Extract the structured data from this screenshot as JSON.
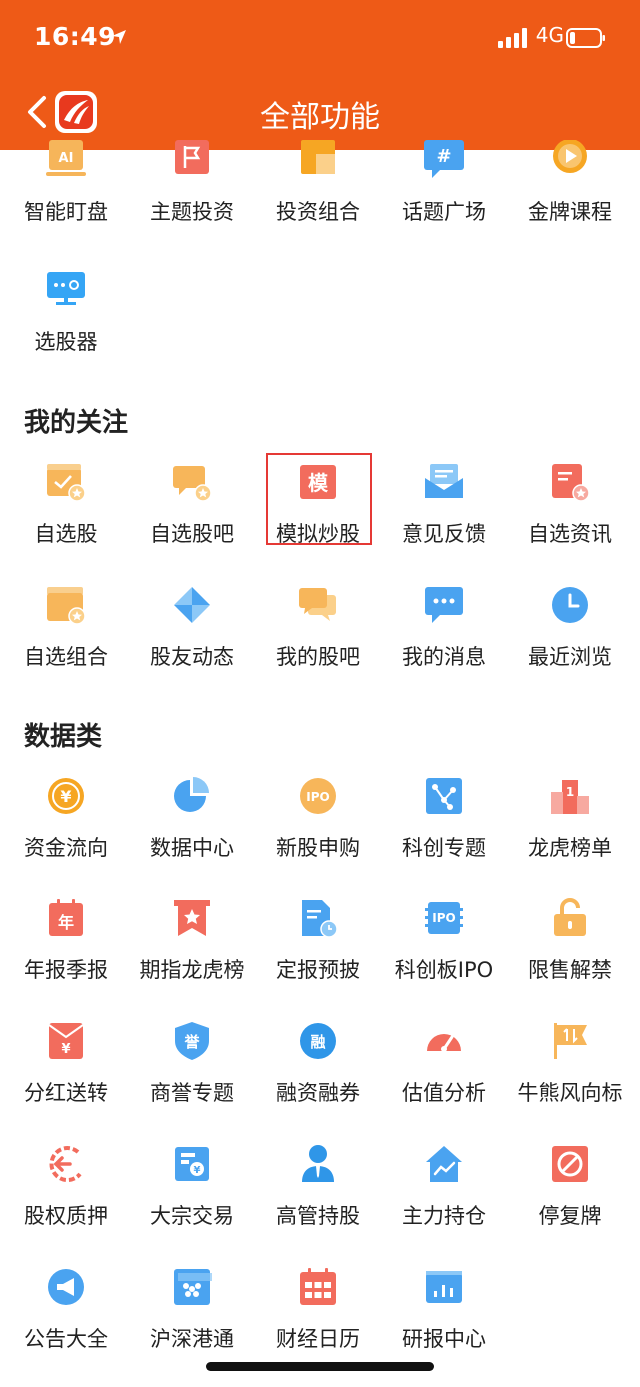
{
  "status": {
    "time": "16:49",
    "network": "4G"
  },
  "header": {
    "title": "全部功能"
  },
  "partial_row": [
    "智能盯盘",
    "主题投资",
    "投资组合",
    "话题广场",
    "金牌课程"
  ],
  "row_extra": [
    "选股器"
  ],
  "section_follow": {
    "title": "我的关注",
    "items": [
      "自选股",
      "自选股吧",
      "模拟炒股",
      "意见反馈",
      "自选资讯",
      "自选组合",
      "股友动态",
      "我的股吧",
      "我的消息",
      "最近浏览"
    ]
  },
  "section_data": {
    "title": "数据类",
    "items": [
      "资金流向",
      "数据中心",
      "新股申购",
      "科创专题",
      "龙虎榜单",
      "年报季报",
      "期指龙虎榜",
      "定报预披",
      "科创板IPO",
      "限售解禁",
      "分红送转",
      "商誉专题",
      "融资融券",
      "估值分析",
      "牛熊风向标",
      "股权质押",
      "大宗交易",
      "高管持股",
      "主力持仓",
      "停复牌",
      "公告大全",
      "沪深港通",
      "财经日历",
      "研报中心"
    ]
  },
  "icon_text": {
    "ai": "AI",
    "mo": "模",
    "ipo": "IPO",
    "one": "1",
    "nian": "年",
    "yu": "誉",
    "rong": "融",
    "yen": "¥",
    "hash": "#"
  },
  "colors": {
    "accent": "#ee5a17",
    "highlight": "#e53935"
  }
}
